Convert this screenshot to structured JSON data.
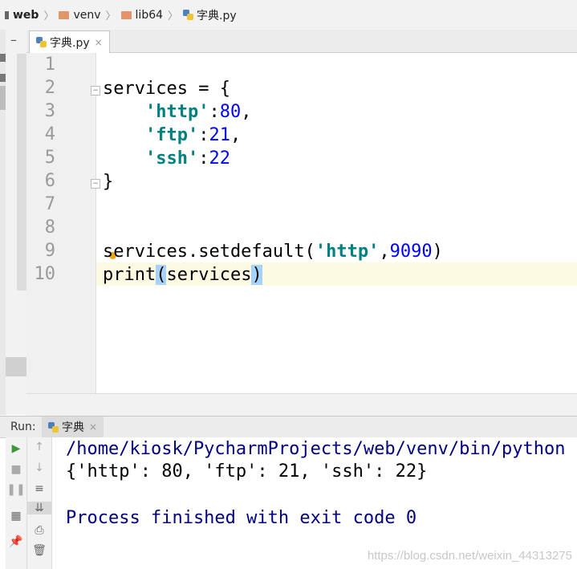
{
  "breadcrumb": [
    {
      "label": "web",
      "icon": "project-icon"
    },
    {
      "label": "venv",
      "icon": "folder-icon"
    },
    {
      "label": "lib64",
      "icon": "folder-icon"
    },
    {
      "label": "字典.py",
      "icon": "python-file-icon"
    }
  ],
  "editor": {
    "tab": {
      "label": "字典.py",
      "close": "×"
    },
    "line_numbers": [
      "1",
      "2",
      "3",
      "4",
      "5",
      "6",
      "7",
      "8",
      "9",
      "10"
    ],
    "current_line": "10"
  },
  "code": {
    "l2a": "services = {",
    "l3a": "    ",
    "l3s": "'http'",
    "l3c": ":",
    "l3n": "80",
    "l3e": ",",
    "l4a": "    ",
    "l4s": "'ftp'",
    "l4c": ":",
    "l4n": "21",
    "l4e": ",",
    "l5a": "    ",
    "l5s": "'ssh'",
    "l5c": ":",
    "l5n": "22",
    "l6a": "}",
    "l9a": "services.setdefault(",
    "l9s": "'http'",
    "l9c": ",",
    "l9n": "9090",
    "l9e": ")",
    "l10a": "print",
    "l10b": "(",
    "l10c": "services",
    "l10d": ")"
  },
  "run": {
    "label": "Run:",
    "tab": {
      "label": "字典",
      "close": "×"
    },
    "console": [
      "/home/kiosk/PycharmProjects/web/venv/bin/python",
      "{'http': 80, 'ftp': 21, 'ssh': 22}",
      "",
      "Process finished with exit code 0"
    ]
  },
  "watermark": "https://blog.csdn.net/weixin_44313275",
  "colors": {
    "string": "#008080",
    "number": "#0000ff",
    "console_text": "#000080",
    "brace_highlight": "#a6d2ff"
  }
}
